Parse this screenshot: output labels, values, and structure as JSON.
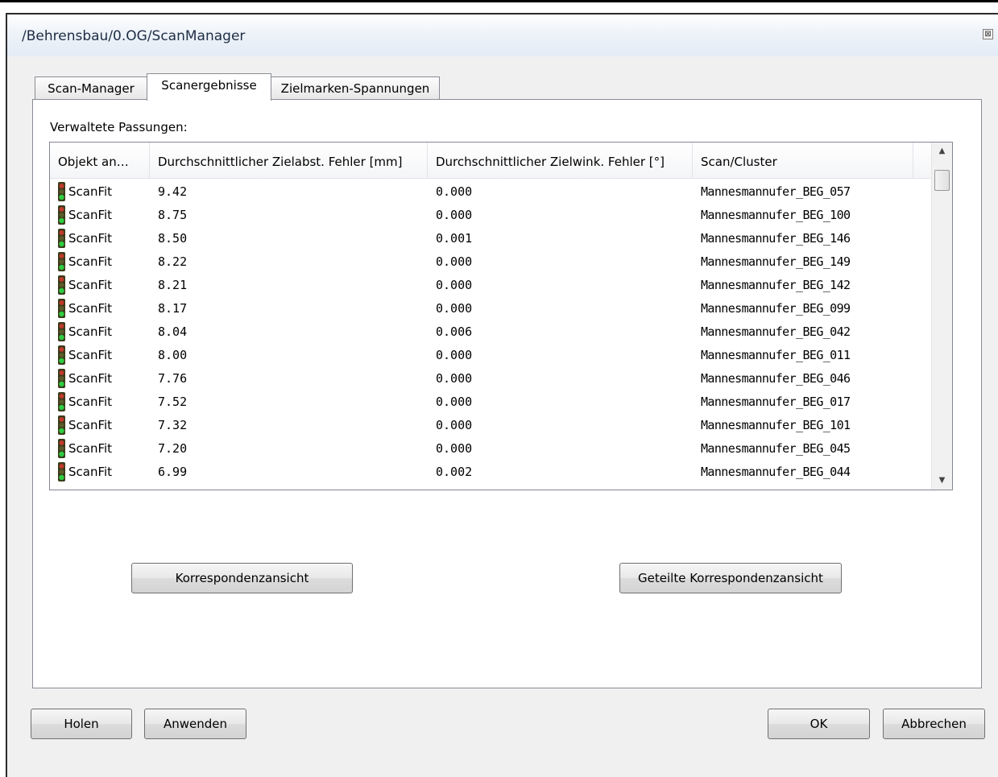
{
  "window": {
    "title": "/Behrensbau/0.OG/ScanManager",
    "close_glyph": "⊠"
  },
  "tabs": [
    {
      "label": "Scan-Manager",
      "active": false
    },
    {
      "label": "Scanergebnisse",
      "active": true
    },
    {
      "label": "Zielmarken-Spannungen",
      "active": false
    }
  ],
  "section": {
    "label": "Verwaltete Passungen:"
  },
  "table": {
    "columns": [
      "Objekt an…",
      "Durchschnittlicher Zielabst. Fehler [mm]",
      "Durchschnittlicher Zielwink. Fehler [°]",
      "Scan/Cluster"
    ],
    "rows": [
      {
        "object": "ScanFit",
        "dist_error": "9.42",
        "angle_error": "0.000",
        "scan": "Mannesmannufer_BEG_057"
      },
      {
        "object": "ScanFit",
        "dist_error": "8.75",
        "angle_error": "0.000",
        "scan": "Mannesmannufer_BEG_100"
      },
      {
        "object": "ScanFit",
        "dist_error": "8.50",
        "angle_error": "0.001",
        "scan": "Mannesmannufer_BEG_146"
      },
      {
        "object": "ScanFit",
        "dist_error": "8.22",
        "angle_error": "0.000",
        "scan": "Mannesmannufer_BEG_149"
      },
      {
        "object": "ScanFit",
        "dist_error": "8.21",
        "angle_error": "0.000",
        "scan": "Mannesmannufer_BEG_142"
      },
      {
        "object": "ScanFit",
        "dist_error": "8.17",
        "angle_error": "0.000",
        "scan": "Mannesmannufer_BEG_099"
      },
      {
        "object": "ScanFit",
        "dist_error": "8.04",
        "angle_error": "0.006",
        "scan": "Mannesmannufer_BEG_042"
      },
      {
        "object": "ScanFit",
        "dist_error": "8.00",
        "angle_error": "0.000",
        "scan": "Mannesmannufer_BEG_011"
      },
      {
        "object": "ScanFit",
        "dist_error": "7.76",
        "angle_error": "0.000",
        "scan": "Mannesmannufer_BEG_046"
      },
      {
        "object": "ScanFit",
        "dist_error": "7.52",
        "angle_error": "0.000",
        "scan": "Mannesmannufer_BEG_017"
      },
      {
        "object": "ScanFit",
        "dist_error": "7.32",
        "angle_error": "0.000",
        "scan": "Mannesmannufer_BEG_101"
      },
      {
        "object": "ScanFit",
        "dist_error": "7.20",
        "angle_error": "0.000",
        "scan": "Mannesmannufer_BEG_045"
      },
      {
        "object": "ScanFit",
        "dist_error": "6.99",
        "angle_error": "0.002",
        "scan": "Mannesmannufer_BEG_044"
      }
    ],
    "row_icon": "traffic-light-icon",
    "scroll_up_glyph": "▲",
    "scroll_down_glyph": "▼"
  },
  "panel_buttons": {
    "correspondence": "Korrespondenzansicht",
    "split_correspondence": "Geteilte Korrespondenzansicht"
  },
  "footer_buttons": {
    "fetch": "Holen",
    "apply": "Anwenden",
    "ok": "OK",
    "cancel": "Abbrechen"
  },
  "colors": {
    "title_text": "#1e2d44",
    "light_red": "#c0392b",
    "light_green": "#2ecc40",
    "light_body": "#3a3a1a"
  }
}
